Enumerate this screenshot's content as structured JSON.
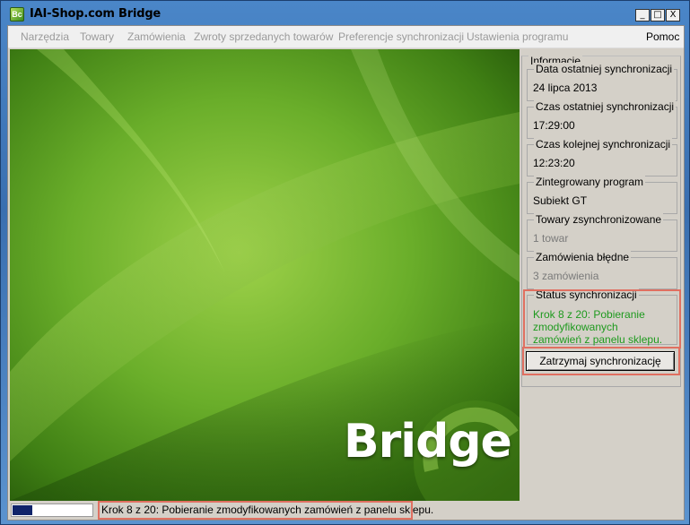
{
  "window": {
    "title": "IAI-Shop.com Bridge",
    "icon_text": "Bc"
  },
  "title_controls": {
    "minimize": "_",
    "maximize": "□",
    "close": "X"
  },
  "menu": {
    "items": [
      "Narzędzia",
      "Towary",
      "Zamówienia",
      "Zwroty sprzedanych towarów",
      "Preferencje synchronizacji",
      "Ustawienia programu"
    ],
    "help": "Pomoc"
  },
  "banner": {
    "logo_text": "Bridge"
  },
  "info": {
    "group_label": "Informacje",
    "last_sync_date": {
      "label": "Data ostatniej synchronizacji",
      "value": "24 lipca 2013"
    },
    "last_sync_time": {
      "label": "Czas ostatniej synchronizacji",
      "value": "17:29:00"
    },
    "next_sync_time": {
      "label": "Czas kolejnej synchronizacji",
      "value": "12:23:20"
    },
    "integrated_program": {
      "label": "Zintegrowany program",
      "value": "Subiekt GT"
    },
    "synced_products": {
      "label": "Towary zsynchronizowane",
      "value": "1 towar"
    },
    "failed_orders": {
      "label": "Zamówienia błędne",
      "value": "3 zamówienia"
    },
    "sync_status": {
      "label": "Status synchronizacji",
      "value": "Krok 8 z 20: Pobieranie zmodyfikowanych zamówień z panelu sklepu."
    }
  },
  "stop_button": {
    "label": "Zatrzymaj synchronizację"
  },
  "statusbar": {
    "progress": 0.25,
    "text": "Krok 8 z 20: Pobieranie zmodyfikowanych zamówień z panelu sklepu."
  },
  "colors": {
    "accent_highlight": "#e07061",
    "status_green": "#1e9a1e",
    "progress_fill": "#10246a"
  }
}
